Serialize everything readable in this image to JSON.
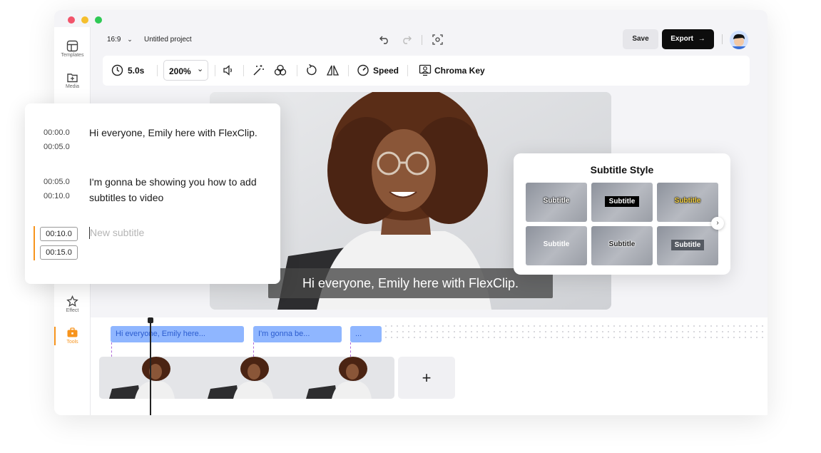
{
  "colors": {
    "accent": "#f7941d",
    "clip": "#8fb6ff",
    "clip_text": "#2b5ccf",
    "dark": "#0d0d0d"
  },
  "sidebar": {
    "items": [
      {
        "label": "Templates",
        "icon": "templates-icon"
      },
      {
        "label": "Media",
        "icon": "media-icon"
      },
      {
        "label": "Effect",
        "icon": "effect-icon"
      },
      {
        "label": "Tools",
        "icon": "tools-icon",
        "active": true
      }
    ]
  },
  "topbar": {
    "ratio": "16:9",
    "project_name": "Untitled project",
    "save_label": "Save",
    "export_label": "Export"
  },
  "toolbar": {
    "duration": "5.0s",
    "zoom": "200%",
    "speed_label": "Speed",
    "chroma_label": "Chroma Key"
  },
  "preview": {
    "caption": "Hi everyone, Emily here with FlexClip."
  },
  "subtitles": {
    "items": [
      {
        "start": "00:00.0",
        "end": "00:05.0",
        "text": "Hi everyone, Emily here with FlexClip."
      },
      {
        "start": "00:05.0",
        "end": "00:10.0",
        "text": "I'm gonna be showing you how to add subtitles to video"
      }
    ],
    "editing": {
      "start": "00:10.0",
      "end": "00:15.0",
      "placeholder": "New subtitle"
    }
  },
  "subtitle_style": {
    "title": "Subtitle Style",
    "tiles": [
      "Subtitle",
      "Subtitle",
      "Subtitle",
      "Subtitle",
      "Subtitle",
      "Subtitle"
    ]
  },
  "timeline": {
    "clips": [
      "Hi everyone, Emily here...",
      "I'm gonna be...",
      "..."
    ],
    "add_label": "+"
  }
}
